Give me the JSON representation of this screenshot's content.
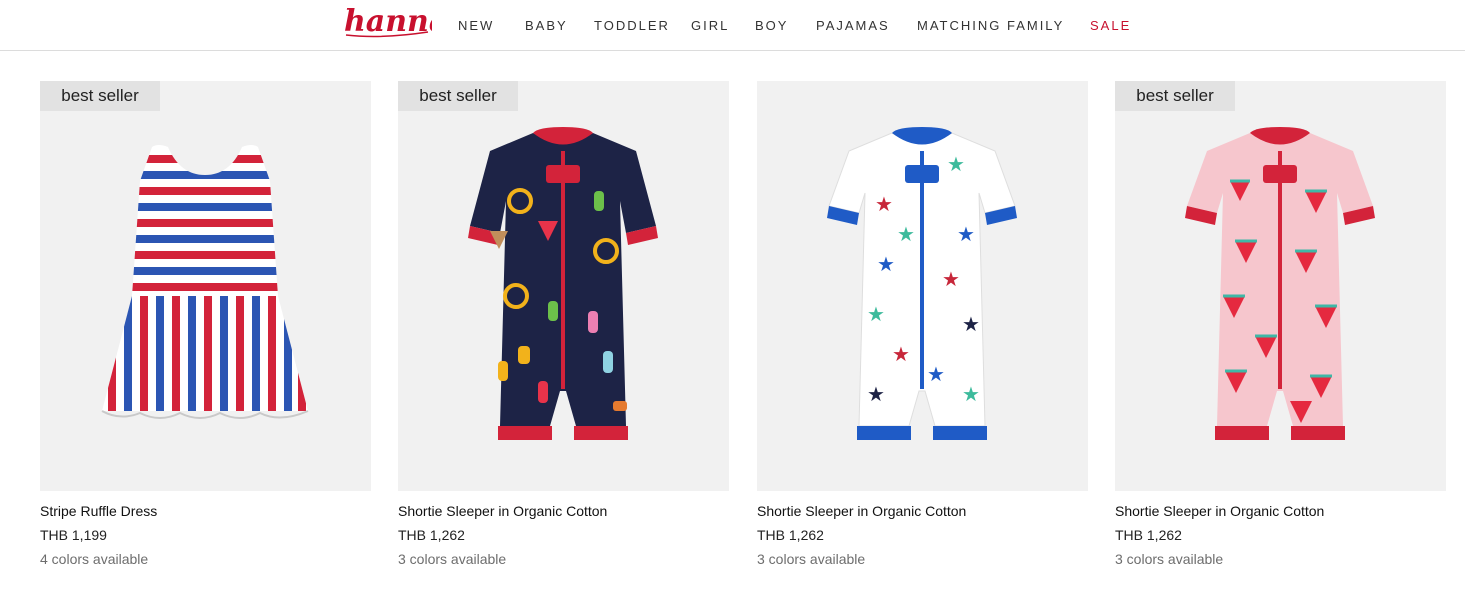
{
  "header": {
    "logo_text": "hanna",
    "nav": [
      {
        "label": "NEW"
      },
      {
        "label": "BABY"
      },
      {
        "label": "TODDLER"
      },
      {
        "label": "GIRL"
      },
      {
        "label": "BOY"
      },
      {
        "label": "PAJAMAS"
      },
      {
        "label": "MATCHING FAMILY"
      },
      {
        "label": "SALE"
      }
    ],
    "sale_color": "#c8102e"
  },
  "products": [
    {
      "badge": "best seller",
      "title": "Stripe Ruffle Dress",
      "price": "THB 1,199",
      "colors": "4 colors available",
      "image_icon": "stripe-ruffle-dress"
    },
    {
      "badge": "best seller",
      "title": "Shortie Sleeper in Organic Cotton",
      "price": "THB 1,262",
      "colors": "3 colors available",
      "image_icon": "navy-snack-print-sleeper"
    },
    {
      "title": "Shortie Sleeper in Organic Cotton",
      "price": "THB 1,262",
      "colors": "3 colors available",
      "image_icon": "white-star-print-sleeper"
    },
    {
      "badge": "best seller",
      "title": "Shortie Sleeper in Organic Cotton",
      "price": "THB 1,262",
      "colors": "3 colors available",
      "image_icon": "pink-watermelon-print-sleeper"
    }
  ]
}
